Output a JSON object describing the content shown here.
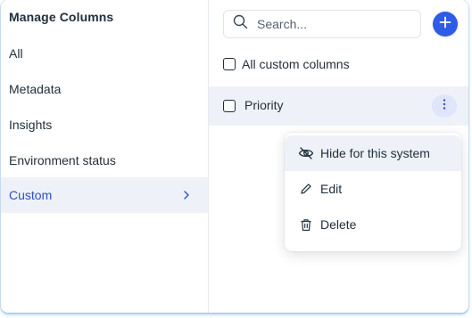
{
  "left_panel": {
    "title": "Manage Columns",
    "items": [
      {
        "label": "All"
      },
      {
        "label": "Metadata"
      },
      {
        "label": "Insights"
      },
      {
        "label": "Environment status"
      },
      {
        "label": "Custom",
        "active": true
      }
    ]
  },
  "right_panel": {
    "search": {
      "placeholder": "Search...",
      "value": ""
    },
    "all_checkbox": {
      "label": "All custom columns",
      "checked": false
    },
    "rows": [
      {
        "label": "Priority",
        "checked": false
      }
    ],
    "context_menu": {
      "items": [
        {
          "label": "Hide for this system",
          "icon": "eye-off-icon"
        },
        {
          "label": "Edit",
          "icon": "pencil-icon"
        },
        {
          "label": "Delete",
          "icon": "trash-icon"
        }
      ]
    }
  },
  "colors": {
    "accent": "#2f5ce6",
    "active_text": "#2c4fc8",
    "selected_bg": "#eff1f8",
    "text": "#20303c"
  }
}
